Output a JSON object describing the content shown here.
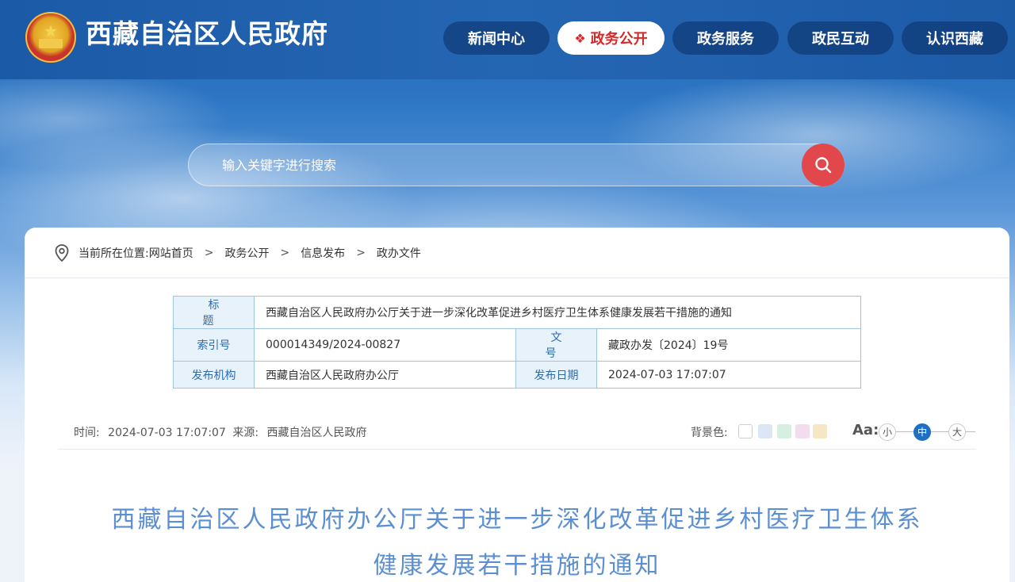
{
  "header": {
    "site_title": "西藏自治区人民政府",
    "nav": [
      {
        "label": "新闻中心",
        "active": false
      },
      {
        "label": "政务公开",
        "active": true
      },
      {
        "label": "政务服务",
        "active": false
      },
      {
        "label": "政民互动",
        "active": false
      },
      {
        "label": "认识西藏",
        "active": false
      }
    ]
  },
  "search": {
    "placeholder": "输入关键字进行搜索"
  },
  "breadcrumb": {
    "prefix": "当前所在位置:",
    "items": [
      "网站首页",
      "政务公开",
      "信息发布",
      "政办文件"
    ],
    "separator": ">"
  },
  "meta_table": {
    "title_label": "标 题",
    "title_value": "西藏自治区人民政府办公厅关于进一步深化改革促进乡村医疗卫生体系健康发展若干措施的通知",
    "index_label": "索引号",
    "index_value": "000014349/2024-00827",
    "docno_label": "文 号",
    "docno_value": "藏政办发〔2024〕19号",
    "org_label": "发布机构",
    "org_value": "西藏自治区人民政府办公厅",
    "date_label": "发布日期",
    "date_value": "2024-07-03 17:07:07"
  },
  "article_info": {
    "time_label": "时间:",
    "time_value": "2024-07-03 17:07:07",
    "source_label": "来源:",
    "source_value": "西藏自治区人民政府",
    "bg_label": "背景色:",
    "bg_colors": [
      "#ffffff",
      "#dce6f5",
      "#d6efe3",
      "#f3dcef",
      "#f5e6c4"
    ],
    "font_sizes": {
      "small": "小",
      "medium": "中",
      "large": "大",
      "selected": "中"
    }
  },
  "document": {
    "title_line1": "西藏自治区人民政府办公厅关于进一步深化改革促进乡村医疗卫生体系",
    "title_line2": "健康发展若干措施的通知"
  },
  "colors": {
    "brand_blue": "#1f5fae",
    "accent_red": "#e2474b",
    "title_blue": "#5b8fd1",
    "label_bg": "#e8f2fb"
  }
}
